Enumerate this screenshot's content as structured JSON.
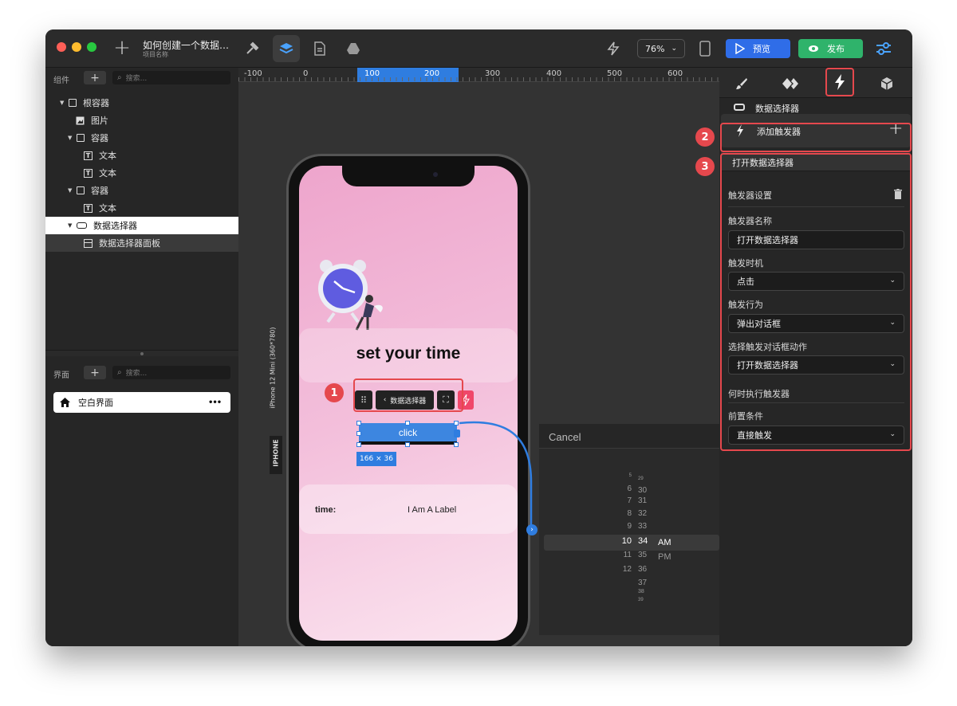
{
  "toolbar": {
    "project_title": "如何创建一个数据…",
    "project_subtitle": "项目名称",
    "zoom": "76%",
    "preview_label": "预览",
    "publish_label": "发布"
  },
  "sidebar": {
    "components_label": "组件",
    "search_placeholder": "搜索...",
    "tree": [
      {
        "label": "根容器"
      },
      {
        "label": "图片"
      },
      {
        "label": "容器"
      },
      {
        "label": "文本"
      },
      {
        "label": "文本"
      },
      {
        "label": "容器"
      },
      {
        "label": "文本"
      },
      {
        "label": "数据选择器"
      },
      {
        "label": "数据选择器面板"
      }
    ],
    "pages_label": "界面",
    "pages_search_placeholder": "搜索...",
    "page_item": "空白界面",
    "page_more": "•••"
  },
  "ruler": {
    "ticks": [
      "-100",
      "0",
      "100",
      "200",
      "300",
      "400",
      "500",
      "600"
    ]
  },
  "phone": {
    "device_label": "iPhone 12 Mini (360*780)",
    "device_tab": "IPHONE",
    "heading": "set your time",
    "float_label": "数据选择器",
    "button_label": "click",
    "size_tag": "166 × 36",
    "time_label": "time:",
    "time_value": "I Am A Label"
  },
  "picker": {
    "cancel": "Cancel",
    "hours": [
      "5",
      "6",
      "7",
      "8",
      "9",
      "10",
      "11",
      "12"
    ],
    "minutes": [
      "29",
      "30",
      "31",
      "32",
      "33",
      "34",
      "35",
      "36",
      "37",
      "38",
      "39"
    ],
    "ampm": [
      "AM",
      "PM"
    ]
  },
  "panel": {
    "component_name": "数据选择器",
    "add_trigger": "添加触发器",
    "trigger_name_header": "打开数据选择器",
    "settings_label": "触发器设置",
    "name_label": "触发器名称",
    "name_value": "打开数据选择器",
    "timing_label": "触发时机",
    "timing_value": "点击",
    "action_label": "触发行为",
    "action_value": "弹出对话框",
    "dialog_action_label": "选择触发对话框动作",
    "dialog_action_value": "打开数据选择器",
    "when_label": "何时执行触发器",
    "precondition_label": "前置条件",
    "precondition_value": "直接触发"
  },
  "badges": [
    "1",
    "2",
    "3"
  ],
  "colors": {
    "accent_blue": "#2f6de8",
    "publish_green": "#2fb36b",
    "highlight_red": "#e5484d",
    "trigger_pink": "#f0476a"
  }
}
